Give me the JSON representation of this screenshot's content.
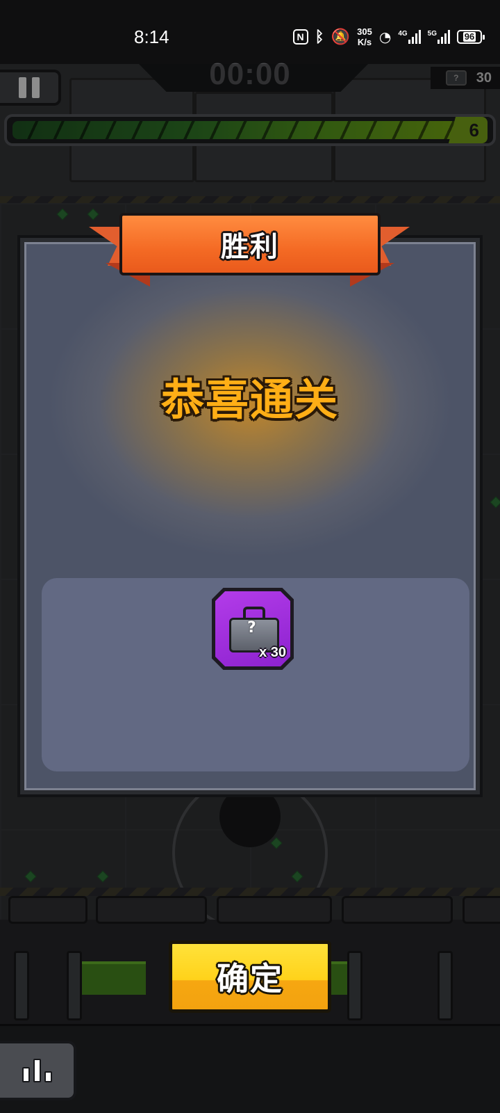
{
  "status_bar": {
    "time": "8:14",
    "nfc": "N",
    "net_speed_value": "305",
    "net_speed_unit": "K/s",
    "sim1_type": "4G",
    "sim2_type": "5G",
    "battery": "96",
    "icons": [
      "nfc-icon",
      "bluetooth-icon",
      "mute-icon",
      "wifi-icon",
      "signal-icon",
      "signal-icon",
      "battery-icon"
    ]
  },
  "hud": {
    "timer": "00:00",
    "chest_count": "30",
    "wave_number": "6",
    "wave_progress": 1.0,
    "pause_icon": "pause-icon"
  },
  "dialog": {
    "banner_title": "胜利",
    "headline": "恭喜通关",
    "rewards": [
      {
        "icon": "mystery-case-icon",
        "mark": "?",
        "quantity": "x 30",
        "rarity_color": "#a231dc"
      }
    ]
  },
  "actions": {
    "confirm_label": "确定",
    "stats_icon": "bar-chart-icon"
  },
  "colors": {
    "banner": "#f46a24",
    "headline": "#ffae16",
    "confirm": "#ffd21a",
    "progress": "#4e8a1a"
  }
}
